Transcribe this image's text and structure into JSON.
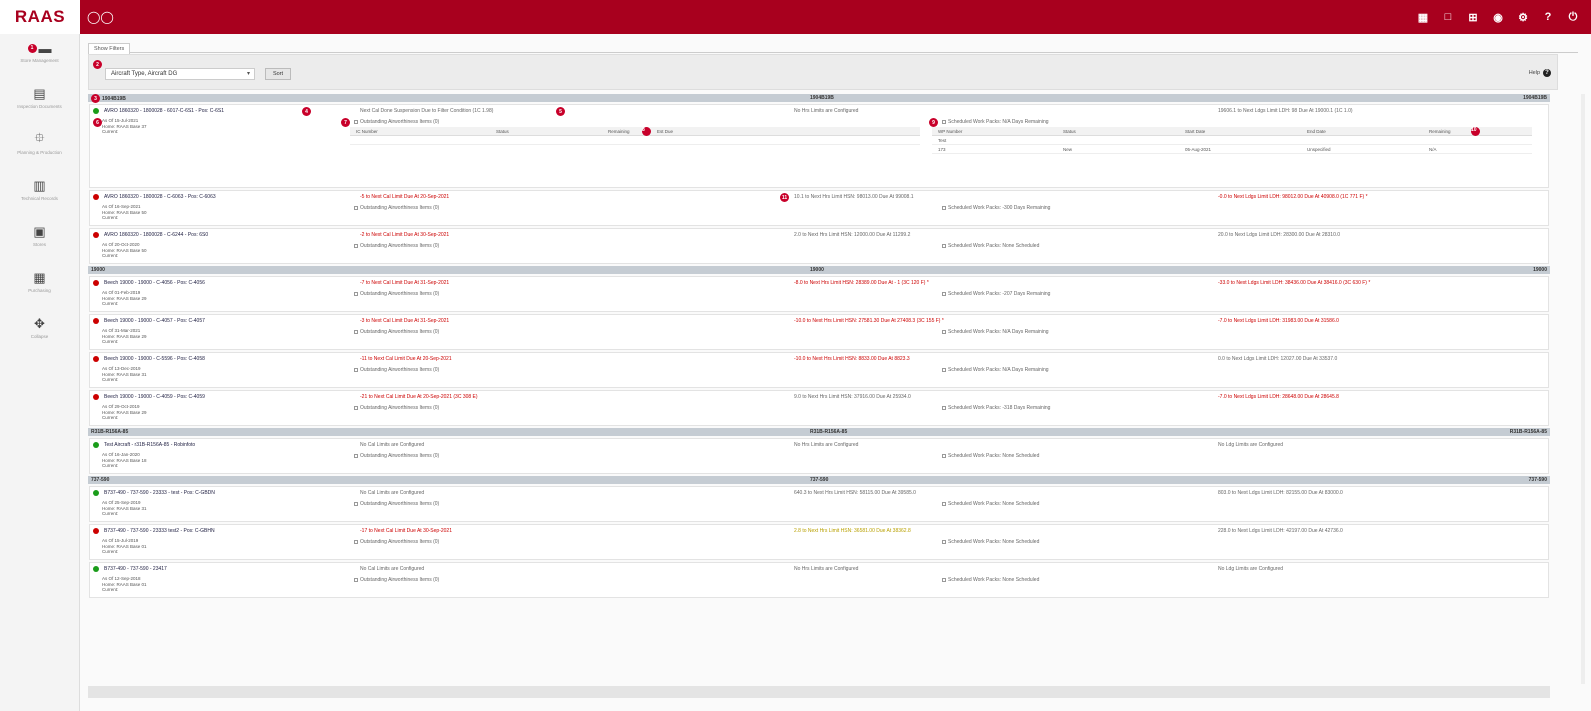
{
  "header": {
    "brand": "RAAS",
    "icons": [
      "binoculars-icon",
      "report-icon",
      "chat-icon",
      "export-icon",
      "globe-icon",
      "settings-icon",
      "help-icon",
      "power-icon"
    ],
    "help_symbol": "?",
    "colors": {
      "primary": "#a8001e",
      "group_header": "#c5ccd3",
      "status_red": "#cc0000",
      "status_green": "#1a9c1a"
    }
  },
  "sidebar": {
    "first_badge": "1",
    "items": [
      {
        "icon": "folder-icon",
        "label": "Store Management"
      },
      {
        "icon": "document-icon",
        "label": "Inspection Documents"
      },
      {
        "icon": "network-icon",
        "label": "Planning & Production"
      },
      {
        "icon": "file-icon",
        "label": "Technical Records"
      },
      {
        "icon": "clipboard-icon",
        "label": "Stores"
      },
      {
        "icon": "calculator-icon",
        "label": "Purchasing"
      },
      {
        "icon": "collapse-icon",
        "label": "Collapse"
      }
    ]
  },
  "toolbar": {
    "tab_label": "Show Filters",
    "filter_badge": "2",
    "group_select_value": "Aircraft Type, Aircraft DG",
    "sort_label": "Sort",
    "help_label": "Help"
  },
  "groups": [
    {
      "name": "1904B19B",
      "badge": "3",
      "cards": [
        {
          "status": "green",
          "tall": true,
          "title": "AVRO 1860320 - 1800028 - 6017-C-6S1 - Pos: C-6S1",
          "title_badge": "4",
          "cal": "Next Cal Done Suspension Due to Filter Condition (1C 1.98)",
          "cal_badge": "5",
          "hrs": "No Hrs Limits are Configured",
          "ldg": "19606.1 to Next Ldgs Limit LDH: 98 Due At 19000.1 (1C 1.0)",
          "asof": [
            "As Of 15-Jul-2021",
            "Home: RAAS Base 37",
            "Current:"
          ],
          "asof_badge": "6",
          "oam_label": "Outstanding Airworthiness Items (0)",
          "oam_badge": "7",
          "oam_cols": [
            "IC Number",
            "Status",
            "Remaining",
            "Est Due"
          ],
          "oam_col_badge": "8",
          "wp_label": "Scheduled Work Packs: N/A Days Remaining",
          "wp_badge": "9",
          "wp_cols": [
            "WP Number",
            "Status",
            "Start Date",
            "End Date",
            "Remaining"
          ],
          "wp_col_badge": "10",
          "wp_rows": [
            [
              "Test",
              "",
              "",
              "",
              ""
            ],
            [
              "173",
              "New",
              "05-Aug-2021",
              "Unspecified",
              "N/A"
            ]
          ]
        },
        {
          "status": "red",
          "title": "AVRO 1860320 - 1800028 - C-6063 - Pos: C-6063",
          "cal": "-5 to Next Cal Limit Due At 20-Sep-2021",
          "hrs": "10.1 to Next Hrs Limit HSN: 98013.00 Due At 99008.1",
          "hrs_badge": "11",
          "ldg": "-0.0 to Next Ldgs Limit LDH: 98012.00 Due At 40908.0 (1C 771 F) *",
          "asof": [
            "As Of 16-Sep-2021",
            "Home: RAAS Base 50",
            "Current:"
          ],
          "oam_label": "Outstanding Airworthiness Items (0)",
          "wp_label": "Scheduled Work Packs: -300 Days Remaining"
        },
        {
          "status": "red",
          "title": "AVRO 1860320 - 1800028 - C-6244 - Pos: 6S0",
          "cal": "-2 to Next Cal Limit Due At 30-Sep-2021",
          "hrs": "2.0 to Next Hrs Limit HSN: 12000.00 Due At 11299.2",
          "ldg": "20.0 to Next Ldgs Limit LDH: 28300.00 Due At 28310.0",
          "asof": [
            "As Of 20-Oct-2020",
            "Home: RAAS Base 50",
            "Current:"
          ],
          "oam_label": "Outstanding Airworthiness Items (0)",
          "wp_label": "Scheduled Work Packs: None Scheduled"
        }
      ]
    },
    {
      "name": "19000",
      "cards": [
        {
          "status": "red",
          "title": "Beech 19000 - 19000 - C-4056 - Pos: C-4056",
          "cal": "-7 to Next Cal Limit Due At 31-Sep-2021",
          "hrs": "-8.0 to Next Hrs Limit HSN: 28389.00 Due At - 1 (3C 120 F) *",
          "ldg": "-33.0 to Next Ldgs Limit LDH: 38436.00 Due At 38416.0 (3C 630 F) *",
          "asof": [
            "As Of 01-Feb-2019",
            "Home: RAAS Base 29",
            "Current:"
          ],
          "oam_label": "Outstanding Airworthiness Items (0)",
          "wp_label": "Scheduled Work Packs: -207 Days Remaining"
        },
        {
          "status": "red",
          "title": "Beech 19000 - 19000 - C-4057 - Pos: C-4057",
          "cal": "-3 to Next Cal Limit Due At 31-Sep-2021",
          "hrs": "-10.0 to Next Hrs Limit HSN: 27581.30 Due At 27408.3 (3C 155 F) *",
          "ldg": "-7.0 to Next Ldgs Limit LDH: 31983.00 Due At 31586.0",
          "asof": [
            "As Of 31-Mar-2021",
            "Home: RAAS Base 29",
            "Current:"
          ],
          "oam_label": "Outstanding Airworthiness Items (0)",
          "wp_label": "Scheduled Work Packs: N/A Days Remaining"
        },
        {
          "status": "red",
          "title": "Beech 19000 - 19000 - C-5596 - Pos: C-4058",
          "cal": "-11 to Next Cal Limit Due At 20-Sep-2021",
          "hrs": "-10.0 to Next Hrs Limit HSN: 8833.00 Due At 8823.3",
          "ldg": "0.0 to Next Ldgs Limit LDH: 12027.00 Due At 33537.0",
          "asof": [
            "As Of 13-Dec-2019",
            "Home: RAAS Base 31",
            "Current:"
          ],
          "oam_label": "Outstanding Airworthiness Items (0)",
          "wp_label": "Scheduled Work Packs: N/A Days Remaining"
        },
        {
          "status": "red",
          "title": "Beech 19000 - 19000 - C-4059 - Pos: C-4059",
          "cal": "-21 to Next Cal Limit Due At 20-Sep-2021 (3C 308 E)",
          "hrs": "9.0 to Next Hrs Limit HSN: 37916.00 Due At 25934.0",
          "ldg": "-7.0 to Next Ldgs Limit LDH: 28648.00 Due At 28645.8",
          "asof": [
            "As Of 29-Oct-2019",
            "Home: RAAS Base 29",
            "Current:"
          ],
          "oam_label": "Outstanding Airworthiness Items (0)",
          "wp_label": "Scheduled Work Packs: -318 Days Remaining"
        }
      ]
    },
    {
      "name": "R31B-R156A-85",
      "cards": [
        {
          "status": "green",
          "title": "Test Aircraft - r31B-R156A-85 - Robinfoto",
          "cal": "No Cal Limits are Configured",
          "hrs": "No Hrs Limits are Configured",
          "ldg": "No Ldg Limits are Configured",
          "asof": [
            "As Of 16-Jan-2020",
            "Home: RAAS Base 18",
            "Current:"
          ],
          "oam_label": "Outstanding Airworthiness Items (0)",
          "wp_label": "Scheduled Work Packs: None Scheduled"
        }
      ]
    },
    {
      "name": "737-590",
      "cards": [
        {
          "status": "green",
          "title": "B737-490 - 737-590 - 23333 - test - Pos: C-GBDN",
          "cal": "No Cal Limits are Configured",
          "hrs": "640.3 to Next Hrs Limit HSN: 58115.00 Due At 39585.0",
          "ldg": "803.0 to Next Ldgs Limit LDH: 82155.00 Due At 83000.0",
          "asof": [
            "As Of 25-Sep-2019",
            "Home: RAAS Base 31",
            "Current:"
          ],
          "oam_label": "Outstanding Airworthiness Items (0)",
          "wp_label": "Scheduled Work Packs: None Scheduled"
        },
        {
          "status": "red",
          "title": "B737-490 - 737-590 - 23333 test2 - Pos: C-GBHN",
          "cal": "-17 to Next Cal Limit Due At 30-Sep-2021",
          "hrs": "2.8 to Next Hrs Limit HSN: 36581.00 Due At 38362.8",
          "ldg": "228.0 to Next Ldgs Limit LDH: 42197.00 Due At 42736.0",
          "hrs_color": "amber",
          "asof": [
            "As Of 15-Jul-2019",
            "Home: RAAS Base 01",
            "Current:"
          ],
          "oam_label": "Outstanding Airworthiness Items (0)",
          "wp_label": "Scheduled Work Packs: None Scheduled"
        },
        {
          "status": "green",
          "title": "B737-490 - 737-590 - 23417",
          "cal": "No Cal Limits are Configured",
          "hrs": "No Hrs Limits are Configured",
          "ldg": "No Ldg Limits are Configured",
          "asof": [
            "As Of 12-Sep-2018",
            "Home: RAAS Base 01",
            "Current:"
          ],
          "oam_label": "Outstanding Airworthiness Items (0)",
          "wp_label": "Scheduled Work Packs: None Scheduled"
        }
      ]
    }
  ]
}
